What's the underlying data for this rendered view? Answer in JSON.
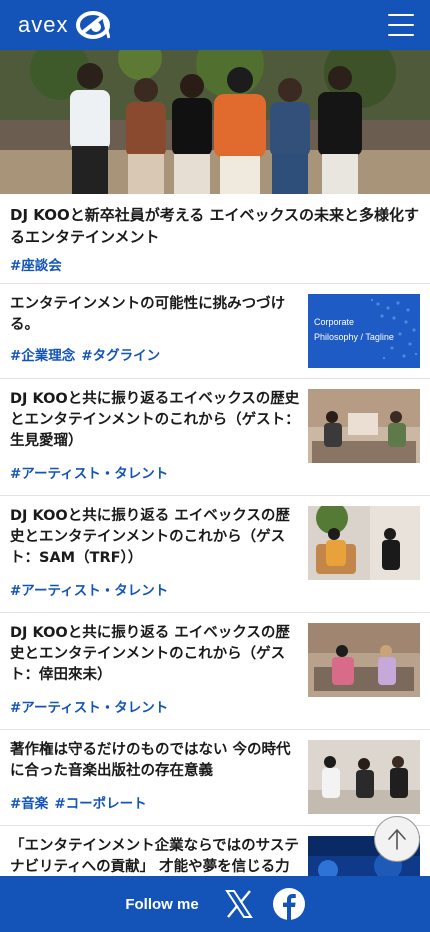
{
  "header": {
    "logo_text": "avex",
    "menu_icon": "hamburger-menu-icon"
  },
  "feature": {
    "title": "DJ KOOと新卒社員が考える エイベックスの未来と多様化するエンタテインメント",
    "tags": [
      "#座談会"
    ]
  },
  "articles": [
    {
      "title": "エンタテインメントの可能性に挑みつづける。",
      "tags": [
        "#企業理念",
        "#タグライン"
      ],
      "thumb_caption": [
        "Corporate",
        "Philosophy / Tagline"
      ]
    },
    {
      "title": "DJ KOOと共に振り返るエイベックスの歴史とエンタテインメントのこれから（ゲスト：生見愛瑠）",
      "tags": [
        "#アーティスト・タレント"
      ]
    },
    {
      "title": "DJ KOOと共に振り返る エイベックスの歴史とエンタテインメントのこれから（ゲスト：SAM（TRF））",
      "tags": [
        "#アーティスト・タレント"
      ]
    },
    {
      "title": "DJ KOOと共に振り返る エイベックスの歴史とエンタテインメントのこれから（ゲスト：倖田來未）",
      "tags": [
        "#アーティスト・タレント"
      ]
    },
    {
      "title": "著作権は守るだけのものではない 今の時代に合った音楽出版社の存在意義",
      "tags": [
        "#音楽",
        "#コーポレート"
      ]
    },
    {
      "title": "「エンタテインメント企業ならではのサステナビリティへの貢献」 才能や夢を信じる力を",
      "tags": []
    }
  ],
  "footer": {
    "follow_label": "Follow me",
    "social": [
      "x-logo-icon",
      "facebook-logo-icon"
    ]
  },
  "colors": {
    "brand_blue": "#1454b8",
    "tag_blue": "#1454b8",
    "divider": "#e3e3e3"
  }
}
